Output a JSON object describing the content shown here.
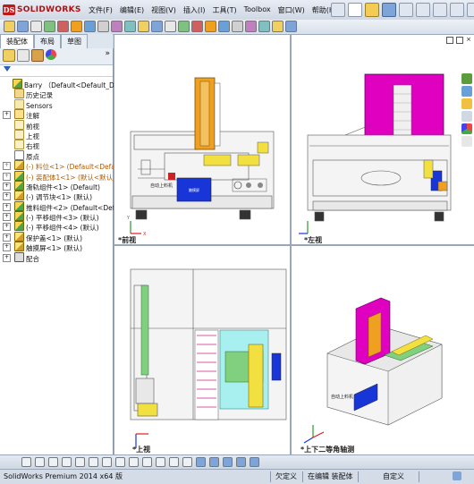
{
  "app": {
    "logo_text": "SOLIDWORKS"
  },
  "menu": [
    "文件(F)",
    "编辑(E)",
    "视图(V)",
    "插入(I)",
    "工具(T)",
    "Toolbox",
    "窗口(W)",
    "帮助(H)"
  ],
  "panel_tabs": [
    "装配体",
    "布局",
    "草图"
  ],
  "tree": {
    "root": "Barry （Default<Default_D",
    "items": [
      {
        "label": "历史记录",
        "type": "hist",
        "expand": false
      },
      {
        "label": "Sensors",
        "type": "sens",
        "expand": false
      },
      {
        "label": "注解",
        "type": "note",
        "expand": true
      },
      {
        "label": "前视",
        "type": "plane",
        "expand": false
      },
      {
        "label": "上视",
        "type": "plane",
        "expand": false
      },
      {
        "label": "右视",
        "type": "plane",
        "expand": false
      },
      {
        "label": "原点",
        "type": "origin",
        "expand": false
      },
      {
        "label": "(-) 料位<1> (Default<Defau",
        "type": "part",
        "expand": true,
        "warn": true
      },
      {
        "label": "(-) 装配体1<1> (默认<默认_",
        "type": "asm",
        "expand": true,
        "warn": true
      },
      {
        "label": "滑轨组件<1> (Default)",
        "type": "asm",
        "expand": true
      },
      {
        "label": "(-) 调节块<1> (默认)",
        "type": "part",
        "expand": true
      },
      {
        "label": "推料组件<2> (Default<Defa",
        "type": "asm",
        "expand": true
      },
      {
        "label": "(-) 平移组件<3> (默认)",
        "type": "asm",
        "expand": true
      },
      {
        "label": "(-) 平移组件<4> (默认)",
        "type": "asm",
        "expand": true
      },
      {
        "label": "保护盖<1> (默认)",
        "type": "part",
        "expand": true
      },
      {
        "label": "触摸屏<1> (默认)",
        "type": "part",
        "expand": true
      },
      {
        "label": "配合",
        "type": "mate",
        "expand": true
      }
    ]
  },
  "viewports": [
    {
      "label": "*前视",
      "name": "front"
    },
    {
      "label": "*左视",
      "name": "left"
    },
    {
      "label": "*上视",
      "name": "top"
    },
    {
      "label": "*上下二等角轴测",
      "name": "iso"
    }
  ],
  "model_text": {
    "panel_label": "自动上料机",
    "screen_label": "触摸屏"
  },
  "status": {
    "app_version": "SolidWorks Premium 2014 x64 版",
    "undefined": "欠定义",
    "editing": "在编辑 装配体",
    "custom": "自定义"
  },
  "colors": {
    "accent": "#c01818",
    "magenta": "#e000c0",
    "orange": "#f0a020",
    "yellow": "#f2e040",
    "blue": "#1836d8",
    "cyan": "#a8f0f0",
    "green": "#80d080"
  }
}
